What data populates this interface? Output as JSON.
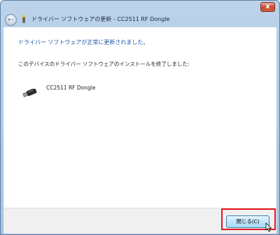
{
  "window": {
    "title": "ドライバー ソフトウェアの更新 - CC2511 RF Dongle",
    "close_glyph": "x"
  },
  "nav": {
    "back_glyph": "←"
  },
  "content": {
    "heading": "ドライバー ソフトウェアが正常に更新されました。",
    "message": "このデバイスのドライバー ソフトウェアのインストールを終了しました:",
    "device_name": "CC2511 RF Dongle",
    "device_icon": "usb-dongle-icon"
  },
  "footer": {
    "close_label": "閉じる(C)"
  },
  "colors": {
    "heading": "#1c5aa8",
    "highlight": "#e8151e"
  }
}
